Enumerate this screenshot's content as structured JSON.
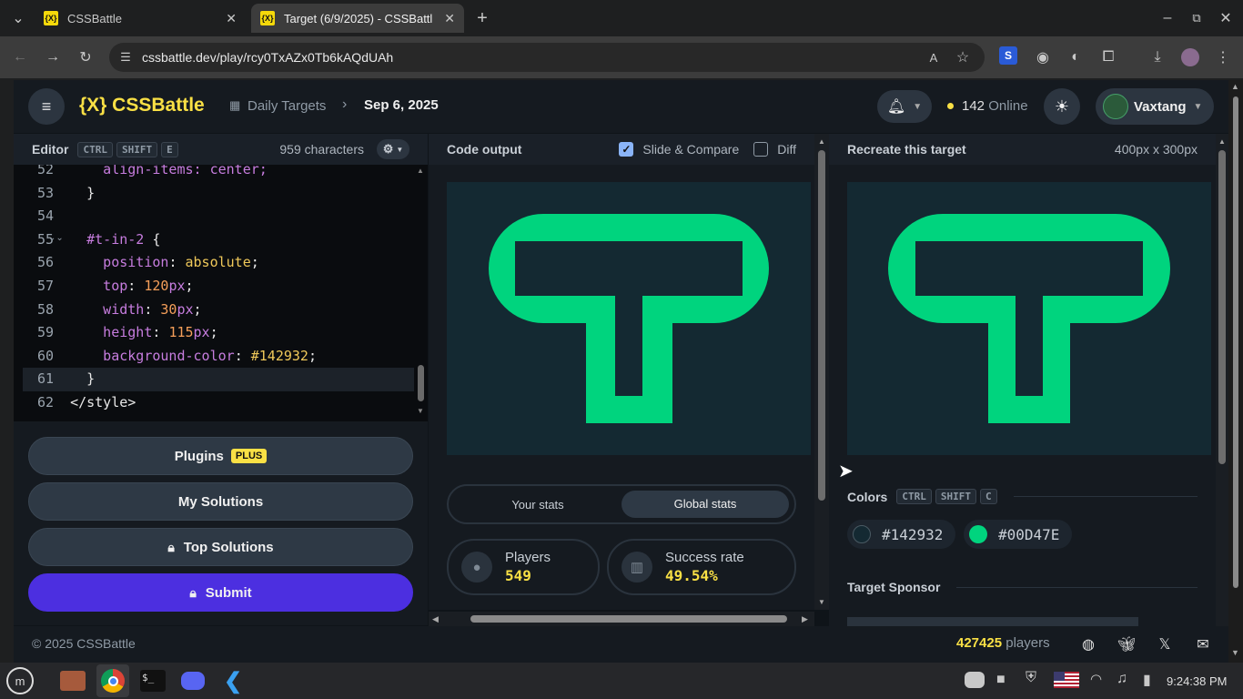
{
  "browser": {
    "tabs": [
      {
        "label": "CSSBattle",
        "favicon": "{X}"
      },
      {
        "label": "Target (6/9/2025) - CSSBattl",
        "favicon": "{X}"
      }
    ],
    "url": "cssbattle.dev/play/rcy0TxAZx0Tb6kAQdUAh"
  },
  "nav": {
    "logo": "{X} CSSBattle",
    "breadcrumb_root": "Daily Targets",
    "breadcrumb_current": "Sep 6, 2025",
    "online_count": "142",
    "online_label": "Online",
    "username": "Vaxtang"
  },
  "editor": {
    "title": "Editor",
    "shortcut": [
      "CTRL",
      "SHIFT",
      "E"
    ],
    "char_count": "959 characters",
    "lines": [
      {
        "n": "52",
        "parts": [
          {
            "t": "    align-items: center;",
            "c": "kw"
          }
        ]
      },
      {
        "n": "53",
        "parts": [
          {
            "t": "  }",
            "c": "tag"
          }
        ]
      },
      {
        "n": "54",
        "parts": []
      },
      {
        "n": "55",
        "parts": [
          {
            "t": "  #t-in-2 ",
            "c": "sel"
          },
          {
            "t": "{",
            "c": "tag"
          }
        ]
      },
      {
        "n": "56",
        "parts": [
          {
            "t": "    position",
            "c": "kw"
          },
          {
            "t": ": ",
            "c": "tag"
          },
          {
            "t": "absolute",
            "c": "val"
          },
          {
            "t": ";",
            "c": "tag"
          }
        ]
      },
      {
        "n": "57",
        "parts": [
          {
            "t": "    top",
            "c": "kw"
          },
          {
            "t": ": ",
            "c": "tag"
          },
          {
            "t": "120",
            "c": "num"
          },
          {
            "t": "px",
            "c": "kw"
          },
          {
            "t": ";",
            "c": "tag"
          }
        ]
      },
      {
        "n": "58",
        "parts": [
          {
            "t": "    width",
            "c": "kw"
          },
          {
            "t": ": ",
            "c": "tag"
          },
          {
            "t": "30",
            "c": "num"
          },
          {
            "t": "px",
            "c": "kw"
          },
          {
            "t": ";",
            "c": "tag"
          }
        ]
      },
      {
        "n": "59",
        "parts": [
          {
            "t": "    height",
            "c": "kw"
          },
          {
            "t": ": ",
            "c": "tag"
          },
          {
            "t": "115",
            "c": "num"
          },
          {
            "t": "px",
            "c": "kw"
          },
          {
            "t": ";",
            "c": "tag"
          }
        ]
      },
      {
        "n": "60",
        "parts": [
          {
            "t": "    background-color",
            "c": "kw"
          },
          {
            "t": ": ",
            "c": "tag"
          },
          {
            "t": "#142932",
            "c": "val"
          },
          {
            "t": ";",
            "c": "tag"
          }
        ]
      },
      {
        "n": "61",
        "parts": [
          {
            "t": "  }",
            "c": "tag"
          }
        ]
      },
      {
        "n": "62",
        "parts": [
          {
            "t": "</style>",
            "c": "tag"
          }
        ]
      }
    ]
  },
  "sidebar_buttons": {
    "plugins": "Plugins",
    "plugins_badge": "PLUS",
    "my_solutions": "My Solutions",
    "top_solutions": "Top Solutions",
    "submit": "Submit"
  },
  "output": {
    "title": "Code output",
    "slide_compare": "Slide & Compare",
    "diff": "Diff",
    "stats_tabs": [
      "Your stats",
      "Global stats"
    ],
    "players_label": "Players",
    "players_value": "549",
    "success_label": "Success rate",
    "success_value": "49.54%"
  },
  "target": {
    "title": "Recreate this target",
    "size": "400px x 300px",
    "colors_label": "Colors",
    "colors_shortcut": [
      "CTRL",
      "SHIFT",
      "C"
    ],
    "colors": [
      "#142932",
      "#00D47E"
    ],
    "sponsor_label": "Target Sponsor"
  },
  "footer": {
    "copyright": "© 2025 CSSBattle",
    "players_count": "427425",
    "players_label": "players"
  },
  "taskbar": {
    "time": "9:24:38 PM"
  },
  "theme": {
    "bg": "#142932",
    "accent": "#00D47E",
    "brand": "#f9e045",
    "submit": "#4c2fe0"
  }
}
